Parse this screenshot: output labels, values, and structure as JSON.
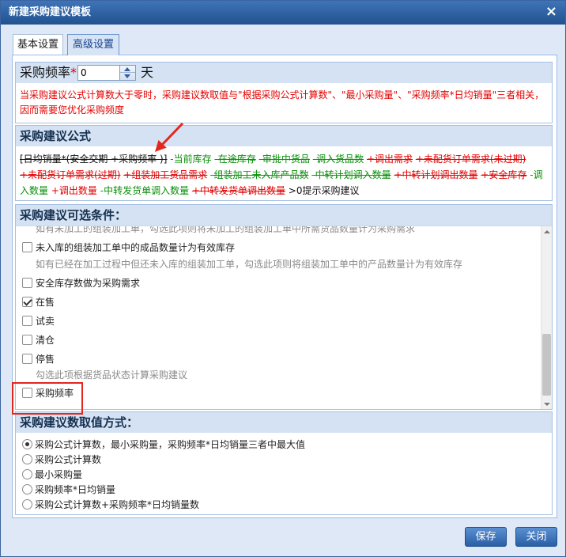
{
  "dialog": {
    "title": "新建采购建议模板",
    "close_label": "×"
  },
  "tabs": [
    {
      "label": "基本设置",
      "active": false
    },
    {
      "label": "高级设置",
      "active": true
    }
  ],
  "frequency": {
    "label": "采购频率",
    "required_mark": "*",
    "value": "0",
    "unit": "天",
    "note": "当采购建议公式计算数大于零时，采购建议数取值与\"根据采购公式计算数\"、\"最小采购量\"、\"采购频率*日均销量\"三者相关，因而需要您优化采购频度"
  },
  "formula": {
    "title": "采购建议公式",
    "terms": [
      {
        "text": "[日均销量*(安全交期 +采购频率 )]",
        "color": "black",
        "strike": true
      },
      {
        "text": "-当前库存",
        "color": "green",
        "strike": false
      },
      {
        "text": "-在途库存",
        "color": "green",
        "strike": true
      },
      {
        "text": "-审批中货品",
        "color": "green",
        "strike": true
      },
      {
        "text": "-调入货品数",
        "color": "green",
        "strike": true
      },
      {
        "text": "+调出需求",
        "color": "red",
        "strike": true
      },
      {
        "text": "+未配货订单需求(未过期)",
        "color": "red",
        "strike": true
      },
      {
        "text": "+未配货订单需求(过期)",
        "color": "red",
        "strike": true
      },
      {
        "text": "+组装加工货品需求",
        "color": "red",
        "strike": true
      },
      {
        "text": "-组装加工未入库产品数",
        "color": "green",
        "strike": true
      },
      {
        "text": "-中转计划调入数量",
        "color": "green",
        "strike": true
      },
      {
        "text": "+中转计划调出数量",
        "color": "red",
        "strike": true
      },
      {
        "text": "+安全库存",
        "color": "red",
        "strike": true
      },
      {
        "text": "-调入数量",
        "color": "green",
        "strike": false
      },
      {
        "text": "+调出数量",
        "color": "red",
        "strike": false
      },
      {
        "text": "-中转发货单调入数量",
        "color": "green",
        "strike": false
      },
      {
        "text": "+中转发货单调出数量",
        "color": "red",
        "strike": true
      },
      {
        "text": ">0提示采购建议",
        "color": "black",
        "strike": false
      }
    ]
  },
  "conditions": {
    "title": "采购建议可选条件：",
    "items": [
      {
        "type": "note",
        "text": "如有未加工的组装加工单，勾选此项则将未加工的组装加工单中所需货品数量计为采购需求"
      },
      {
        "type": "checkbox",
        "label": "未入库的组装加工单中的成品数量计为有效库存",
        "checked": false
      },
      {
        "type": "note",
        "text": "如有已经在加工过程中但还未入库的组装加工单，勾选此项则将组装加工单中的产品数量计为有效库存"
      },
      {
        "type": "checkbox",
        "label": "安全库存数做为采购需求",
        "checked": false
      },
      {
        "type": "checkbox",
        "label": "在售",
        "checked": true
      },
      {
        "type": "checkbox",
        "label": "试卖",
        "checked": false
      },
      {
        "type": "checkbox",
        "label": "清仓",
        "checked": false
      },
      {
        "type": "checkbox",
        "label": "停售",
        "checked": false
      },
      {
        "type": "note",
        "text": "勾选此项根据货品状态计算采购建议"
      },
      {
        "type": "checkbox",
        "label": "采购频率",
        "checked": false
      }
    ]
  },
  "value_mode": {
    "title": "采购建议数取值方式：",
    "options": [
      {
        "label": "采购公式计算数，最小采购量，采购频率*日均销量三者中最大值",
        "selected": true
      },
      {
        "label": "采购公式计算数",
        "selected": false
      },
      {
        "label": "最小采购量",
        "selected": false
      },
      {
        "label": "采购频率*日均销量",
        "selected": false
      },
      {
        "label": "采购公式计算数+采购频率*日均销量数",
        "selected": false
      }
    ]
  },
  "footer": {
    "save_label": "保存",
    "close_label": "关闭"
  },
  "colors": {
    "green": "#0a8f0a",
    "red": "#e00000",
    "black": "#111111",
    "accent": "#2b5fa5",
    "highlight": "#e5261e"
  }
}
